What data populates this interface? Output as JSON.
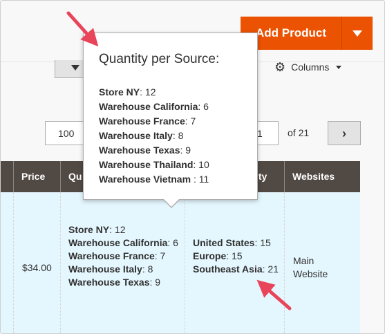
{
  "toolbar": {
    "add_product_label": "Add Product",
    "columns_label": "Columns"
  },
  "pagination": {
    "per_page": "100",
    "current_page": "1",
    "total_pages_label": "of 21"
  },
  "grid": {
    "columns": [
      "Price",
      "Qu",
      "ity",
      "Websites"
    ],
    "row": {
      "price": "$34.00",
      "quantity": [
        {
          "name": "Store NY",
          "value": ": 12"
        },
        {
          "name": "Warehouse California",
          "value": ": 6"
        },
        {
          "name": "Warehouse France",
          "value": ": 7"
        },
        {
          "name": "Warehouse Italy",
          "value": ": 8"
        },
        {
          "name": "Warehouse Texas",
          "value": ": 9"
        }
      ],
      "salable": [
        {
          "name": "United States",
          "value": ": 15"
        },
        {
          "name": "Europe",
          "value": ": 15"
        },
        {
          "name": "Southeast Asia",
          "value": ": 21"
        }
      ],
      "websites": "Main Website"
    }
  },
  "tooltip": {
    "title": "Quantity per Source:",
    "items": [
      {
        "name": "Store NY",
        "value": ": 12"
      },
      {
        "name": "Warehouse California",
        "value": ": 6"
      },
      {
        "name": "Warehouse France",
        "value": ": 7"
      },
      {
        "name": "Warehouse Italy",
        "value": ": 8"
      },
      {
        "name": "Warehouse Texas",
        "value": ": 9"
      },
      {
        "name": "Warehouse Thailand",
        "value": ": 10"
      },
      {
        "name": "Warehouse Vietnam ",
        "value": ": 11"
      }
    ]
  },
  "colors": {
    "accent": "#eb5202",
    "header_bg": "#514943",
    "row_bg": "#e5f7fe",
    "annotation_arrow": "#e8445a"
  },
  "icons": {
    "filter": "filter-icon",
    "columns": "gear-icon",
    "next": "chevron-right-icon",
    "dropdown": "chevron-down-icon"
  }
}
